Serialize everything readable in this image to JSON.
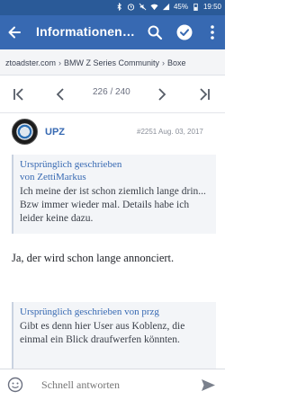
{
  "status_bar": {
    "battery_percent": "45%",
    "time": "19:50",
    "icons": [
      "bluetooth-icon",
      "alarm-icon",
      "mute-icon",
      "wifi-icon",
      "signal-icon",
      "battery-icon"
    ]
  },
  "app_bar": {
    "title": "Informationen…",
    "icons": [
      "back-arrow-icon",
      "search-icon",
      "check-circle-icon",
      "more-vert-icon"
    ]
  },
  "breadcrumb": {
    "items": [
      "ztoadster.com",
      "BMW Z Series Community",
      "Boxe"
    ]
  },
  "pager": {
    "current": "226",
    "total": "240",
    "icons": [
      "first-page-icon",
      "prev-page-icon",
      "next-page-icon",
      "last-page-icon"
    ]
  },
  "post": {
    "username": "UPZ",
    "post_number": "#2251",
    "date": "Aug. 03, 2017",
    "quote1": {
      "header_line1": "Ursprünglich geschrieben",
      "header_line2": "von ZettiMarkus",
      "text": "Ich meine der ist schon ziemlich lange drin... Bzw immer wieder mal. Details habe ich leider keine dazu."
    },
    "body": "Ja, der wird schon lange annonciert.",
    "quote2": {
      "header": "Ursprünglich geschrieben von przg",
      "text": "Gibt es denn hier User aus Koblenz, die einmal ein Blick draufwerfen könnten."
    }
  },
  "reply": {
    "placeholder": "Schnell antworten"
  },
  "colors": {
    "status_bar": "#2a5a98",
    "app_bar": "#3769b2",
    "link": "#3769b2",
    "quote_bg": "#f3f5f8"
  }
}
